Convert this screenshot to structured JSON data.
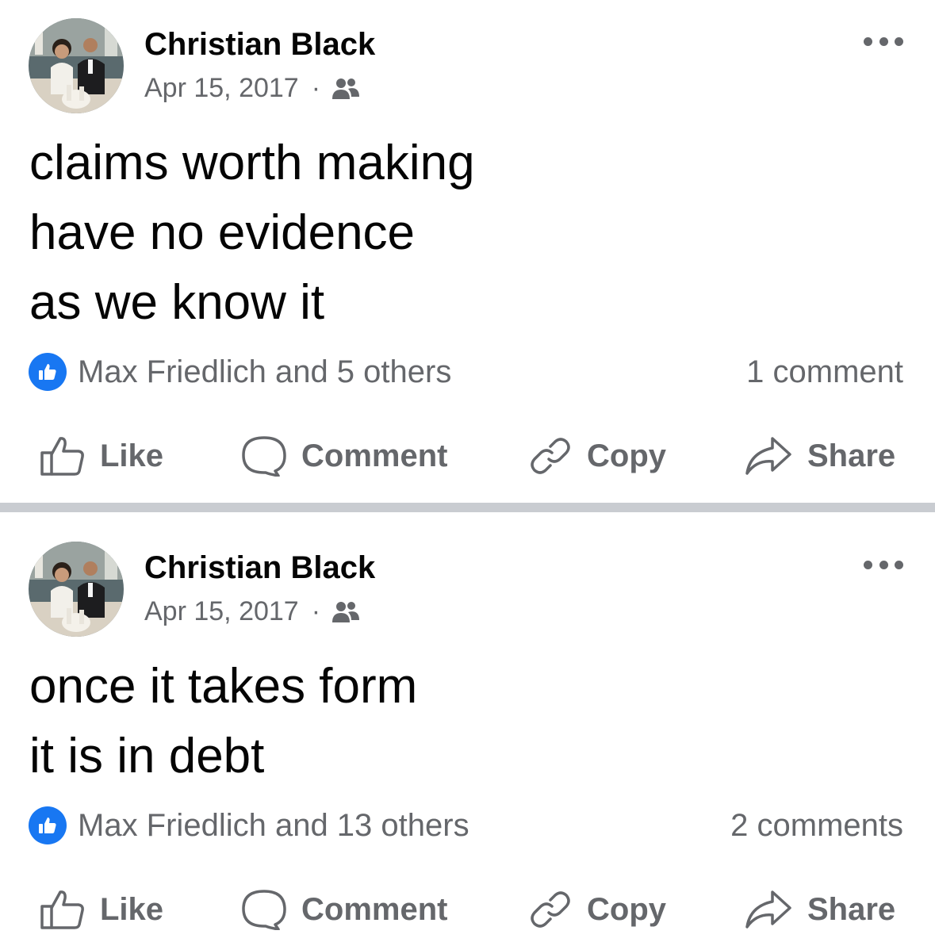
{
  "colors": {
    "text_primary": "#050505",
    "text_secondary": "#65676b",
    "like_blue": "#1877f2",
    "divider": "#c9ccd1"
  },
  "posts": [
    {
      "author": "Christian Black",
      "date": "Apr 15, 2017",
      "separator": "·",
      "audience_icon": "friends-icon",
      "text_lines": [
        "claims worth making",
        "have no evidence",
        "as we know it"
      ],
      "reactions": "Max Friedlich and 5 others",
      "comments": "1 comment",
      "actions": {
        "like": "Like",
        "comment": "Comment",
        "copy": "Copy",
        "share": "Share"
      }
    },
    {
      "author": "Christian Black",
      "date": "Apr 15, 2017",
      "separator": "·",
      "audience_icon": "friends-icon",
      "text_lines": [
        "once it takes form",
        "it is in debt"
      ],
      "reactions": "Max Friedlich and 13 others",
      "comments": "2 comments",
      "actions": {
        "like": "Like",
        "comment": "Comment",
        "copy": "Copy",
        "share": "Share"
      }
    }
  ]
}
